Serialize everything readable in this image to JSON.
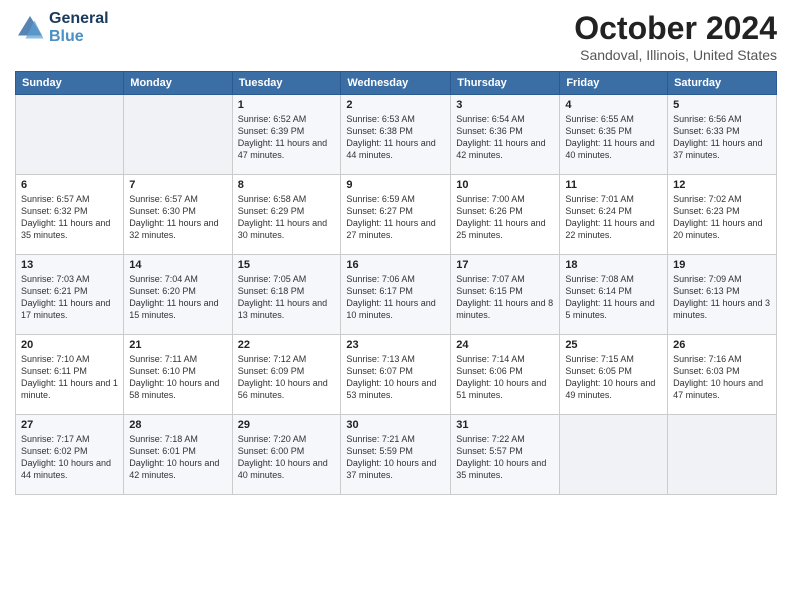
{
  "header": {
    "logo_line1": "General",
    "logo_line2": "Blue",
    "month": "October 2024",
    "location": "Sandoval, Illinois, United States"
  },
  "days_of_week": [
    "Sunday",
    "Monday",
    "Tuesday",
    "Wednesday",
    "Thursday",
    "Friday",
    "Saturday"
  ],
  "weeks": [
    [
      {
        "day": "",
        "info": ""
      },
      {
        "day": "",
        "info": ""
      },
      {
        "day": "1",
        "info": "Sunrise: 6:52 AM\nSunset: 6:39 PM\nDaylight: 11 hours and 47 minutes."
      },
      {
        "day": "2",
        "info": "Sunrise: 6:53 AM\nSunset: 6:38 PM\nDaylight: 11 hours and 44 minutes."
      },
      {
        "day": "3",
        "info": "Sunrise: 6:54 AM\nSunset: 6:36 PM\nDaylight: 11 hours and 42 minutes."
      },
      {
        "day": "4",
        "info": "Sunrise: 6:55 AM\nSunset: 6:35 PM\nDaylight: 11 hours and 40 minutes."
      },
      {
        "day": "5",
        "info": "Sunrise: 6:56 AM\nSunset: 6:33 PM\nDaylight: 11 hours and 37 minutes."
      }
    ],
    [
      {
        "day": "6",
        "info": "Sunrise: 6:57 AM\nSunset: 6:32 PM\nDaylight: 11 hours and 35 minutes."
      },
      {
        "day": "7",
        "info": "Sunrise: 6:57 AM\nSunset: 6:30 PM\nDaylight: 11 hours and 32 minutes."
      },
      {
        "day": "8",
        "info": "Sunrise: 6:58 AM\nSunset: 6:29 PM\nDaylight: 11 hours and 30 minutes."
      },
      {
        "day": "9",
        "info": "Sunrise: 6:59 AM\nSunset: 6:27 PM\nDaylight: 11 hours and 27 minutes."
      },
      {
        "day": "10",
        "info": "Sunrise: 7:00 AM\nSunset: 6:26 PM\nDaylight: 11 hours and 25 minutes."
      },
      {
        "day": "11",
        "info": "Sunrise: 7:01 AM\nSunset: 6:24 PM\nDaylight: 11 hours and 22 minutes."
      },
      {
        "day": "12",
        "info": "Sunrise: 7:02 AM\nSunset: 6:23 PM\nDaylight: 11 hours and 20 minutes."
      }
    ],
    [
      {
        "day": "13",
        "info": "Sunrise: 7:03 AM\nSunset: 6:21 PM\nDaylight: 11 hours and 17 minutes."
      },
      {
        "day": "14",
        "info": "Sunrise: 7:04 AM\nSunset: 6:20 PM\nDaylight: 11 hours and 15 minutes."
      },
      {
        "day": "15",
        "info": "Sunrise: 7:05 AM\nSunset: 6:18 PM\nDaylight: 11 hours and 13 minutes."
      },
      {
        "day": "16",
        "info": "Sunrise: 7:06 AM\nSunset: 6:17 PM\nDaylight: 11 hours and 10 minutes."
      },
      {
        "day": "17",
        "info": "Sunrise: 7:07 AM\nSunset: 6:15 PM\nDaylight: 11 hours and 8 minutes."
      },
      {
        "day": "18",
        "info": "Sunrise: 7:08 AM\nSunset: 6:14 PM\nDaylight: 11 hours and 5 minutes."
      },
      {
        "day": "19",
        "info": "Sunrise: 7:09 AM\nSunset: 6:13 PM\nDaylight: 11 hours and 3 minutes."
      }
    ],
    [
      {
        "day": "20",
        "info": "Sunrise: 7:10 AM\nSunset: 6:11 PM\nDaylight: 11 hours and 1 minute."
      },
      {
        "day": "21",
        "info": "Sunrise: 7:11 AM\nSunset: 6:10 PM\nDaylight: 10 hours and 58 minutes."
      },
      {
        "day": "22",
        "info": "Sunrise: 7:12 AM\nSunset: 6:09 PM\nDaylight: 10 hours and 56 minutes."
      },
      {
        "day": "23",
        "info": "Sunrise: 7:13 AM\nSunset: 6:07 PM\nDaylight: 10 hours and 53 minutes."
      },
      {
        "day": "24",
        "info": "Sunrise: 7:14 AM\nSunset: 6:06 PM\nDaylight: 10 hours and 51 minutes."
      },
      {
        "day": "25",
        "info": "Sunrise: 7:15 AM\nSunset: 6:05 PM\nDaylight: 10 hours and 49 minutes."
      },
      {
        "day": "26",
        "info": "Sunrise: 7:16 AM\nSunset: 6:03 PM\nDaylight: 10 hours and 47 minutes."
      }
    ],
    [
      {
        "day": "27",
        "info": "Sunrise: 7:17 AM\nSunset: 6:02 PM\nDaylight: 10 hours and 44 minutes."
      },
      {
        "day": "28",
        "info": "Sunrise: 7:18 AM\nSunset: 6:01 PM\nDaylight: 10 hours and 42 minutes."
      },
      {
        "day": "29",
        "info": "Sunrise: 7:20 AM\nSunset: 6:00 PM\nDaylight: 10 hours and 40 minutes."
      },
      {
        "day": "30",
        "info": "Sunrise: 7:21 AM\nSunset: 5:59 PM\nDaylight: 10 hours and 37 minutes."
      },
      {
        "day": "31",
        "info": "Sunrise: 7:22 AM\nSunset: 5:57 PM\nDaylight: 10 hours and 35 minutes."
      },
      {
        "day": "",
        "info": ""
      },
      {
        "day": "",
        "info": ""
      }
    ]
  ]
}
